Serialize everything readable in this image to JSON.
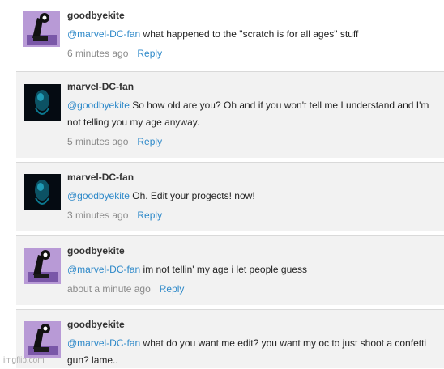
{
  "comments": [
    {
      "username": "goodbyekite",
      "avatar": "purple-robot-avatar",
      "mention": "@marvel-DC-fan",
      "text": "what happened to the \"scratch is for all ages\" stuff",
      "time": "6 minutes ago",
      "reply": "Reply"
    },
    {
      "username": "marvel-DC-fan",
      "avatar": "dark-ghost-avatar",
      "mention": "@goodbyekite",
      "text": "So how old are you? Oh and if you won't tell me I understand and I'm not telling you my age anyway.",
      "time": "5 minutes ago",
      "reply": "Reply"
    },
    {
      "username": "marvel-DC-fan",
      "avatar": "dark-ghost-avatar",
      "mention": "@goodbyekite",
      "text": "Oh. Edit your progects! now!",
      "time": "3 minutes ago",
      "reply": "Reply"
    },
    {
      "username": "goodbyekite",
      "avatar": "purple-robot-avatar",
      "mention": "@marvel-DC-fan",
      "text": "im not tellin' my age i let people guess",
      "time": "about a minute ago",
      "reply": "Reply"
    },
    {
      "username": "goodbyekite",
      "avatar": "purple-robot-avatar",
      "mention": "@marvel-DC-fan",
      "text": "what do you want me edit? you want my oc to just shoot a confetti gun? lame..",
      "time": "",
      "reply": ""
    }
  ],
  "watermark": "imgflip.com",
  "colors": {
    "link": "#2e89c9",
    "nested_bg": "#f2f2f2",
    "timestamp": "#8a8a8a"
  }
}
